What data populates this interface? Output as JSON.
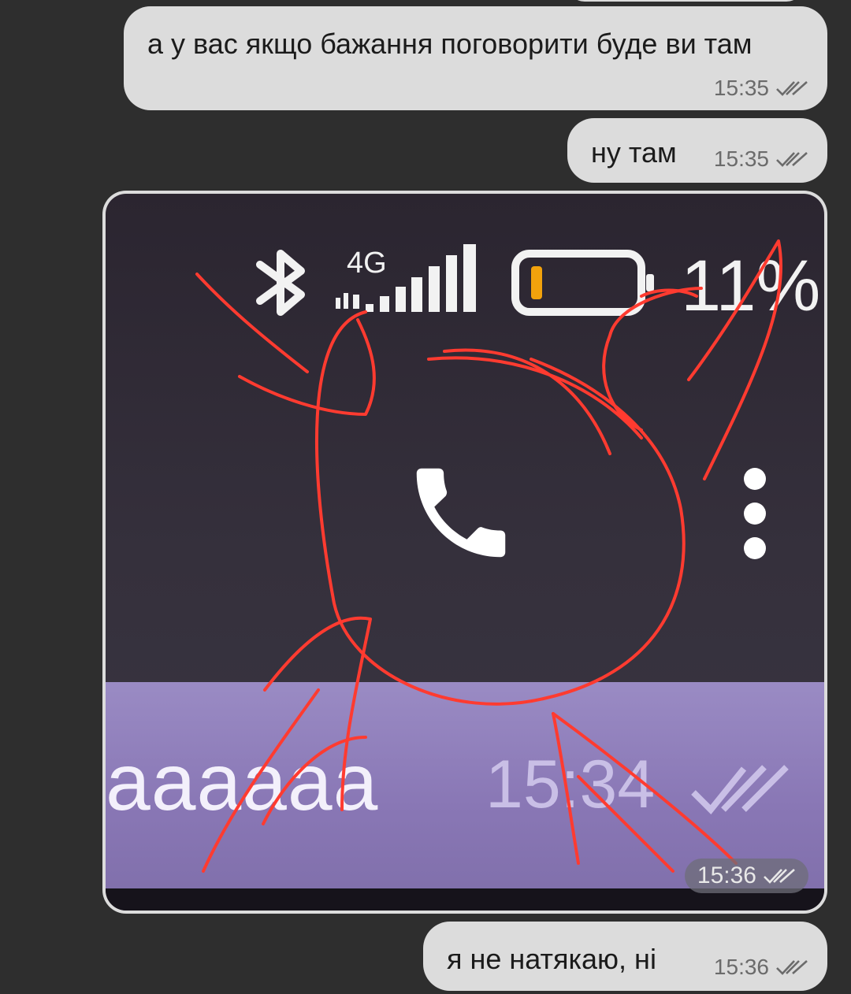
{
  "messages": [
    {
      "text": "а у вас якщо бажання поговорити буде ви там",
      "time": "15:35",
      "status": "read"
    },
    {
      "text": "ну там",
      "time": "15:35",
      "status": "read"
    },
    {
      "type": "photo",
      "time": "15:36",
      "status": "read",
      "photo": {
        "network_label": "4G",
        "battery_percent": "11%",
        "quoted_message_text": "аааааа",
        "quoted_message_time": "15:34",
        "annotation": "red-freehand-circle-and-arrows"
      }
    },
    {
      "text": "я не натякаю, ні",
      "time": "15:36",
      "status": "read"
    }
  ],
  "colors": {
    "background": "#2e2e2e",
    "bubble": "#dcdcdc",
    "annotation_red": "#ff3b30",
    "photo_purple": "#8977b5",
    "battery_level": "#f2a20c"
  }
}
